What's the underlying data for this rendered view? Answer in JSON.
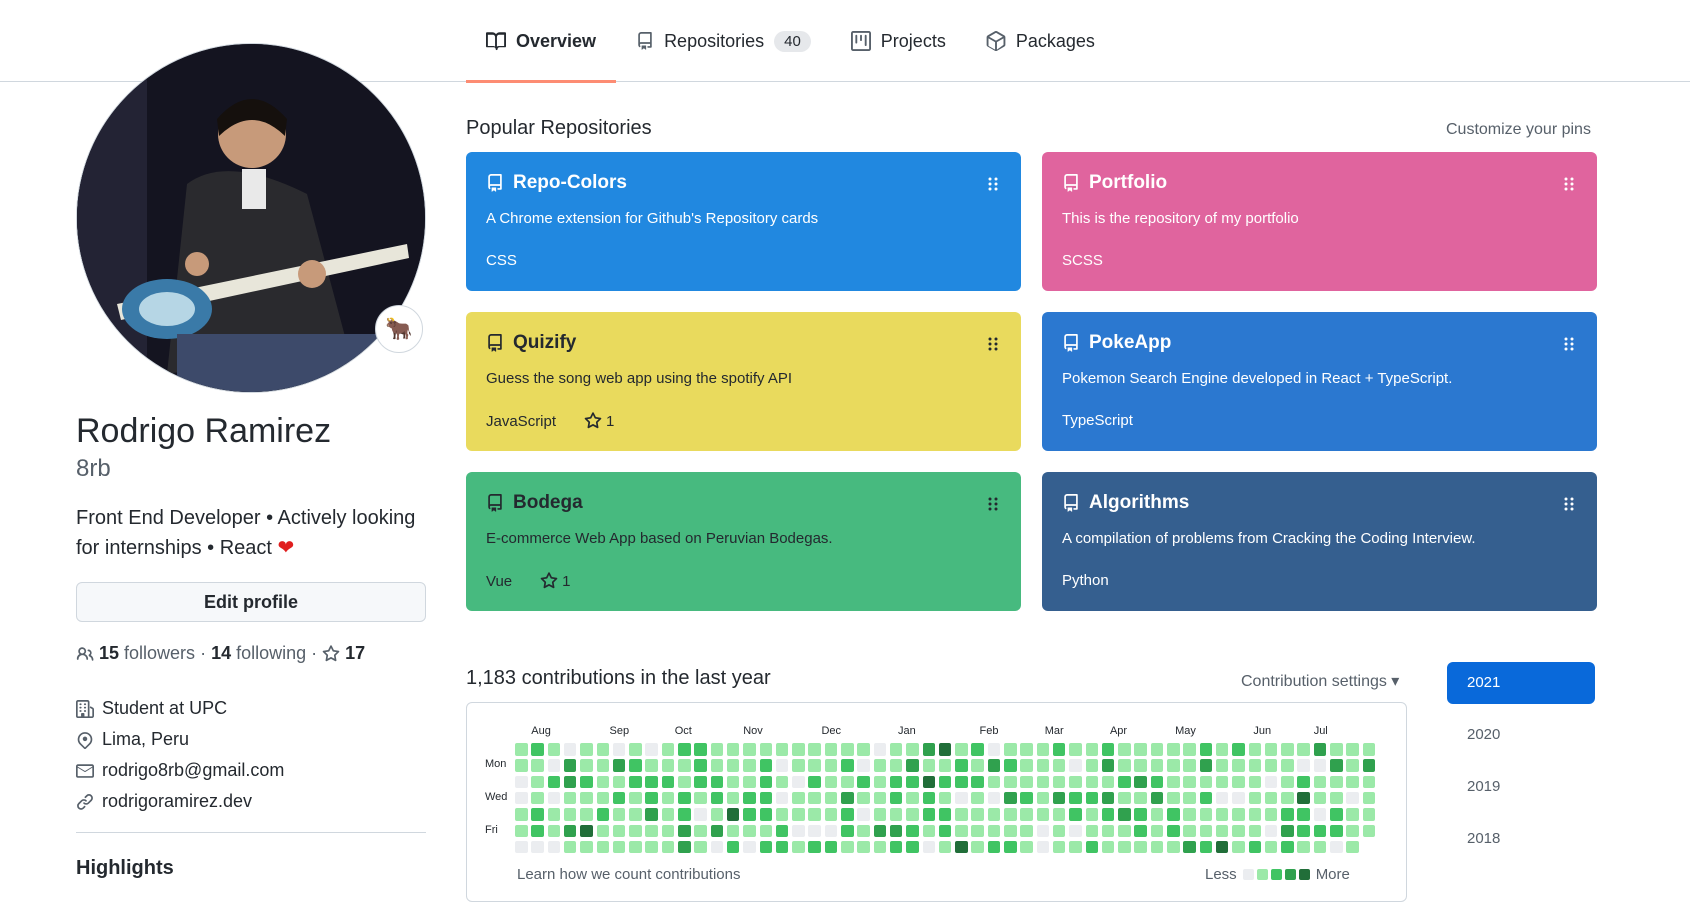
{
  "nav": {
    "tabs": [
      {
        "label": "Overview"
      },
      {
        "label": "Repositories",
        "count": "40"
      },
      {
        "label": "Projects"
      },
      {
        "label": "Packages"
      }
    ]
  },
  "profile": {
    "status_emoji": "🐂",
    "name": "Rodrigo Ramirez",
    "login": "8rb",
    "bio": "Front End Developer • Actively looking for internships • React",
    "edit_label": "Edit profile",
    "followers_count": "15",
    "followers_label": "followers",
    "following_count": "14",
    "following_label": "following",
    "stars_count": "17",
    "org": "Student at UPC",
    "location": "Lima, Peru",
    "email": "rodrigo8rb@gmail.com",
    "website": "rodrigoramirez.dev",
    "highlights": "Highlights"
  },
  "popular": {
    "title": "Popular Repositories",
    "customize": "Customize your pins",
    "repos": [
      {
        "name": "Repo-Colors",
        "desc": "A Chrome extension for Github's Repository cards",
        "lang": "CSS",
        "stars": "",
        "color": "#2188e0"
      },
      {
        "name": "Portfolio",
        "desc": "This is the repository of my portfolio",
        "lang": "SCSS",
        "stars": "",
        "color": "#e0649e"
      },
      {
        "name": "Quizify",
        "desc": "Guess the song web app using the spotify API",
        "lang": "JavaScript",
        "stars": "1",
        "color": "#e9da5d",
        "dark": true
      },
      {
        "name": "PokeApp",
        "desc": "Pokemon Search Engine developed in React + TypeScript.",
        "lang": "TypeScript",
        "stars": "",
        "color": "#2b78d0"
      },
      {
        "name": "Bodega",
        "desc": "E-commerce Web App based on Peruvian Bodegas.",
        "lang": "Vue",
        "stars": "1",
        "color": "#47ba7f",
        "dark": true
      },
      {
        "name": "Algorithms",
        "desc": "A compilation of problems from Cracking the Coding Interview.",
        "lang": "Python",
        "stars": "",
        "color": "#355f8f"
      }
    ]
  },
  "contributions": {
    "title": "1,183 contributions in the last year",
    "settings": "Contribution settings ▾",
    "months": [
      "Aug",
      "Sep",
      "Oct",
      "Nov",
      "Dec",
      "Jan",
      "Feb",
      "Mar",
      "Apr",
      "May",
      "Jun",
      "Jul"
    ],
    "days": [
      "Mon",
      "Wed",
      "Fri"
    ],
    "learn": "Learn how we count contributions",
    "less": "Less",
    "more": "More",
    "level_colors": [
      "#ebedf0",
      "#9be9a8",
      "#40c463",
      "#30a14e",
      "#216e39"
    ],
    "years": [
      "2021",
      "2020",
      "2019",
      "2018"
    ]
  }
}
